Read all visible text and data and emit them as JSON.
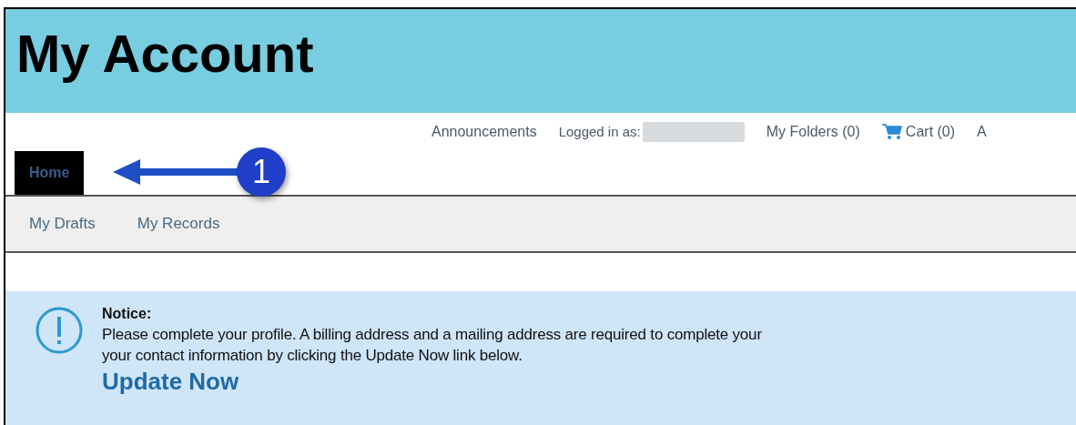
{
  "header": {
    "title": "My Account"
  },
  "top_links": [
    {
      "kind": "link",
      "label": "Announcements"
    },
    {
      "kind": "user",
      "label": "Logged in as:"
    },
    {
      "kind": "link",
      "label": "My Folders (0)"
    },
    {
      "kind": "cart",
      "label": "Cart (0)"
    },
    {
      "kind": "link",
      "label": "A"
    }
  ],
  "tabs": [
    {
      "label": "Home",
      "selected": true
    }
  ],
  "subnav": [
    {
      "label": "My Drafts"
    },
    {
      "label": "My Records"
    }
  ],
  "callout": {
    "number": "1"
  },
  "notice": {
    "title": "Notice:",
    "lines": [
      "Please complete your profile. A billing address and a mailing address are required to complete your",
      "your contact information by clicking the Update Now link below."
    ],
    "link": "Update Now"
  }
}
